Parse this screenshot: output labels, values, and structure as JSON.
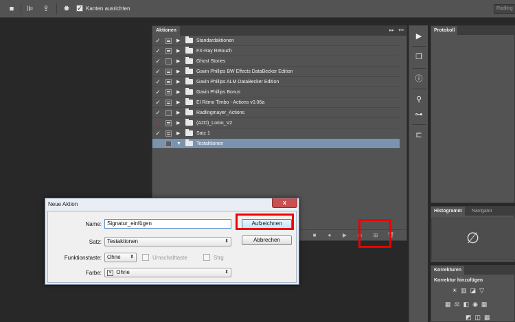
{
  "options_bar": {
    "align_edges_label": "Kanten ausrichten",
    "align_edges_checked": true,
    "workspace_label": "Radling"
  },
  "actions_panel": {
    "tab_label": "Aktionen",
    "collapse_label": "▸▸",
    "menu_label": "▾≡",
    "sets": [
      {
        "name": "Standardaktionen",
        "checked": true,
        "check_color": "#e8e8e8",
        "dialog_toggle": true,
        "selected": false,
        "expanded": false
      },
      {
        "name": "FX-Ray Retouch",
        "checked": true,
        "check_color": "#e8e8e8",
        "dialog_toggle": true,
        "selected": false,
        "expanded": false
      },
      {
        "name": "Ghost Stories",
        "checked": true,
        "check_color": "#e8e8e8",
        "dialog_toggle": false,
        "selected": false,
        "expanded": false
      },
      {
        "name": "Gavin Phillips BW Effects DataBecker Edition",
        "checked": true,
        "check_color": "#e8e8e8",
        "dialog_toggle": true,
        "selected": false,
        "expanded": false
      },
      {
        "name": "Gavin Phillips ALM DataBecker Edition",
        "checked": true,
        "check_color": "#e8e8e8",
        "dialog_toggle": true,
        "selected": false,
        "expanded": false
      },
      {
        "name": "Gavin Phillips  Bonus",
        "checked": true,
        "check_color": "#e8e8e8",
        "dialog_toggle": true,
        "selected": false,
        "expanded": false
      },
      {
        "name": "El Ritmo Timbo - Actions v0.06a",
        "checked": true,
        "check_color": "#e8e8e8",
        "dialog_toggle": true,
        "selected": false,
        "expanded": false
      },
      {
        "name": "Radlingmayer_Actions",
        "checked": true,
        "check_color": "#e8e8e8",
        "dialog_toggle": false,
        "selected": false,
        "expanded": false
      },
      {
        "name": "(A2D)_Lomo_V2",
        "checked": true,
        "check_color": "#dd2222",
        "dialog_toggle": true,
        "selected": false,
        "expanded": false
      },
      {
        "name": "Satz 1",
        "checked": true,
        "check_color": "#e8e8e8",
        "dialog_toggle": true,
        "selected": false,
        "expanded": false
      },
      {
        "name": "Testaktionen",
        "checked": false,
        "check_color": "#e8e8e8",
        "dialog_toggle": false,
        "selected": true,
        "expanded": true
      }
    ]
  },
  "right_panels": {
    "protokoll_tab": "Protokoll",
    "histogram_tab": "Histogramm",
    "navigator_tab": "Navigator",
    "histogram_warning_icon": "∅",
    "korrekturen_tab": "Korrekturen",
    "korrekturen_subtitle": "Korrektur hinzufügen"
  },
  "dialog": {
    "title": "Neue Aktion",
    "close_label": "x",
    "name_label": "Name:",
    "name_value": "Signatur_einfügen",
    "satz_label": "Satz:",
    "satz_value": "Testaktionen",
    "funktionstaste_label": "Funktionstaste:",
    "funktionstaste_value": "Ohne",
    "umschalt_label": "Umschalttaste",
    "strg_label": "Strg",
    "farbe_label": "Farbe:",
    "farbe_value": "Ohne",
    "farbe_marker": "×",
    "record_button": "Aufzeichnen",
    "cancel_button": "Abbrechen"
  },
  "colors": {
    "highlight_red": "#e00000",
    "selected_row": "#7b93ad",
    "panel_bg": "#535353"
  }
}
